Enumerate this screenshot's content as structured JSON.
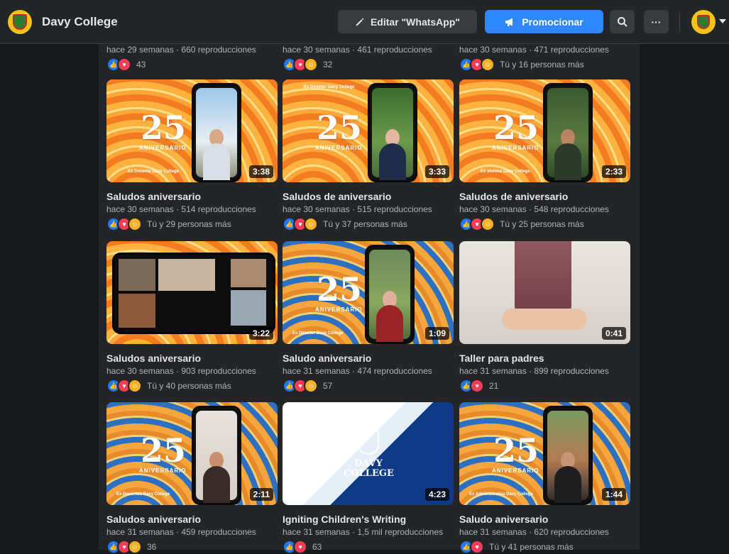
{
  "header": {
    "page_name": "Davy College",
    "edit_label": "Editar \"WhatsApp\"",
    "promote_label": "Promocionar",
    "more_label": "···"
  },
  "top_row": [
    {
      "meta": "hace 29 semanas · 660 reproducciones",
      "reactions_text": "43",
      "reactions": [
        "like",
        "love"
      ]
    },
    {
      "meta": "hace 30 semanas · 461 reproducciones",
      "reactions_text": "32",
      "reactions": [
        "like",
        "love",
        "care"
      ]
    },
    {
      "meta": "hace 30 semanas · 471 reproducciones",
      "reactions_text": "Tú y 16 personas más",
      "reactions": [
        "like",
        "love",
        "care"
      ]
    }
  ],
  "videos": [
    {
      "title": "Saludos aniversario",
      "meta": "hace 30 semanas · 514 reproducciones",
      "duration": "3:38",
      "reactions_text": "Tú y 29 personas más"
    },
    {
      "title": "Saludos de aniversario",
      "meta": "hace 30 semanas · 515 reproducciones",
      "duration": "3:33",
      "reactions_text": "Tú y 37 personas más"
    },
    {
      "title": "Saludos de aniversario",
      "meta": "hace 30 semanas · 548 reproducciones",
      "duration": "2:33",
      "reactions_text": "Tú y 25 personas más"
    },
    {
      "title": "Saludos aniversario",
      "meta": "hace 30 semanas · 903 reproducciones",
      "duration": "3:22",
      "reactions_text": "Tú y 40 personas más"
    },
    {
      "title": "Saludo aniversario",
      "meta": "hace 31 semanas · 474 reproducciones",
      "duration": "1:09",
      "reactions_text": "57"
    },
    {
      "title": "Taller para padres",
      "meta": "hace 31 semanas · 899 reproducciones",
      "duration": "0:41",
      "reactions_text": "21"
    },
    {
      "title": "Saludos aniversario",
      "meta": "hace 31 semanas · 459 reproducciones",
      "duration": "2:11",
      "reactions_text": "36"
    },
    {
      "title": "Igniting Children's Writing",
      "meta": "hace 31 semanas · 1,5 mil reproducciones",
      "duration": "4:23",
      "reactions_text": "63"
    },
    {
      "title": "Saludo aniversario",
      "meta": "hace 31 semanas · 620 reproducciones",
      "duration": "1:44",
      "reactions_text": "Tú y 41 personas más"
    }
  ],
  "thumb_text": {
    "ex_docente": "Ex Docente Davy College",
    "ex_director": "Ex Director Davy College",
    "ex_alumno": "Ex alumno Davy College",
    "ex_docentes": "Ex Docentes Davy College",
    "ex_admin": "Ex Administrativa Davy College",
    "anniv_number": "25",
    "anniv_word": "ANIVERSARIO",
    "davy_logo": "DAVY COLLEGE"
  },
  "colors": {
    "background": "#18191a",
    "panel": "#242526",
    "accent": "#2d88ff",
    "text": "#e4e6eb",
    "secondary_text": "#b0b3b8"
  }
}
